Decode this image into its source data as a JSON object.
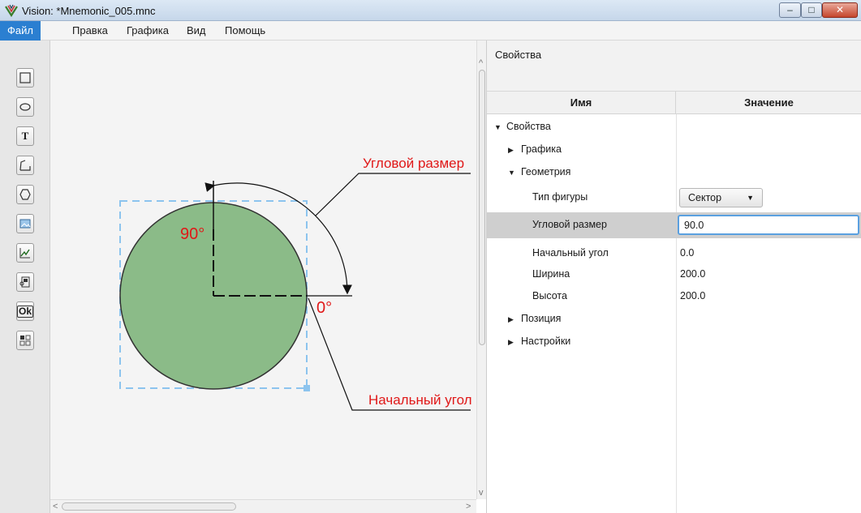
{
  "window": {
    "title": "Vision: *Mnemonic_005.mnc",
    "controls": {
      "minimize": "–",
      "maximize": "□",
      "close": "✕"
    }
  },
  "menu": [
    "Файл",
    "Правка",
    "Графика",
    "Вид",
    "Помощь"
  ],
  "toolbar": {
    "tools": [
      "rectangle-tool",
      "ellipse-tool",
      "text-tool",
      "polyline-tool",
      "polygon-tool",
      "image-tool",
      "chart-tool",
      "device-tool",
      "button-tool",
      "widget-tool"
    ],
    "text_tool_label": "T",
    "ok_tool_label": "Ok"
  },
  "canvas": {
    "annotations": {
      "angular_size": "Угловой размер",
      "start_angle": "Начальный угол",
      "label_90": "90°",
      "label_0": "0°"
    },
    "colors": {
      "fill": "#8bbb88",
      "annotation_red": "#e01818",
      "selection": "#8cc4ee"
    }
  },
  "properties": {
    "title": "Свойства",
    "columns": {
      "name": "Имя",
      "value": "Значение"
    },
    "rows": [
      {
        "label": "Свойства",
        "expander": "▼"
      },
      {
        "label": "Графика",
        "expander": "▶"
      },
      {
        "label": "Геометрия",
        "expander": "▼"
      },
      {
        "label": "Тип фигуры",
        "value": "Сектор"
      },
      {
        "label": "Угловой размер",
        "value": "90.0"
      },
      {
        "label": "Начальный угол",
        "value": "0.0"
      },
      {
        "label": "Ширина",
        "value": "200.0"
      },
      {
        "label": "Высота",
        "value": "200.0"
      },
      {
        "label": "Позиция",
        "expander": "▶"
      },
      {
        "label": "Настройки",
        "expander": "▶"
      }
    ],
    "dropdown_caret": "▼"
  },
  "scrollbars": {
    "left_arrow": "<",
    "right_arrow": ">",
    "up_arrow": "^",
    "down_arrow": "v"
  }
}
